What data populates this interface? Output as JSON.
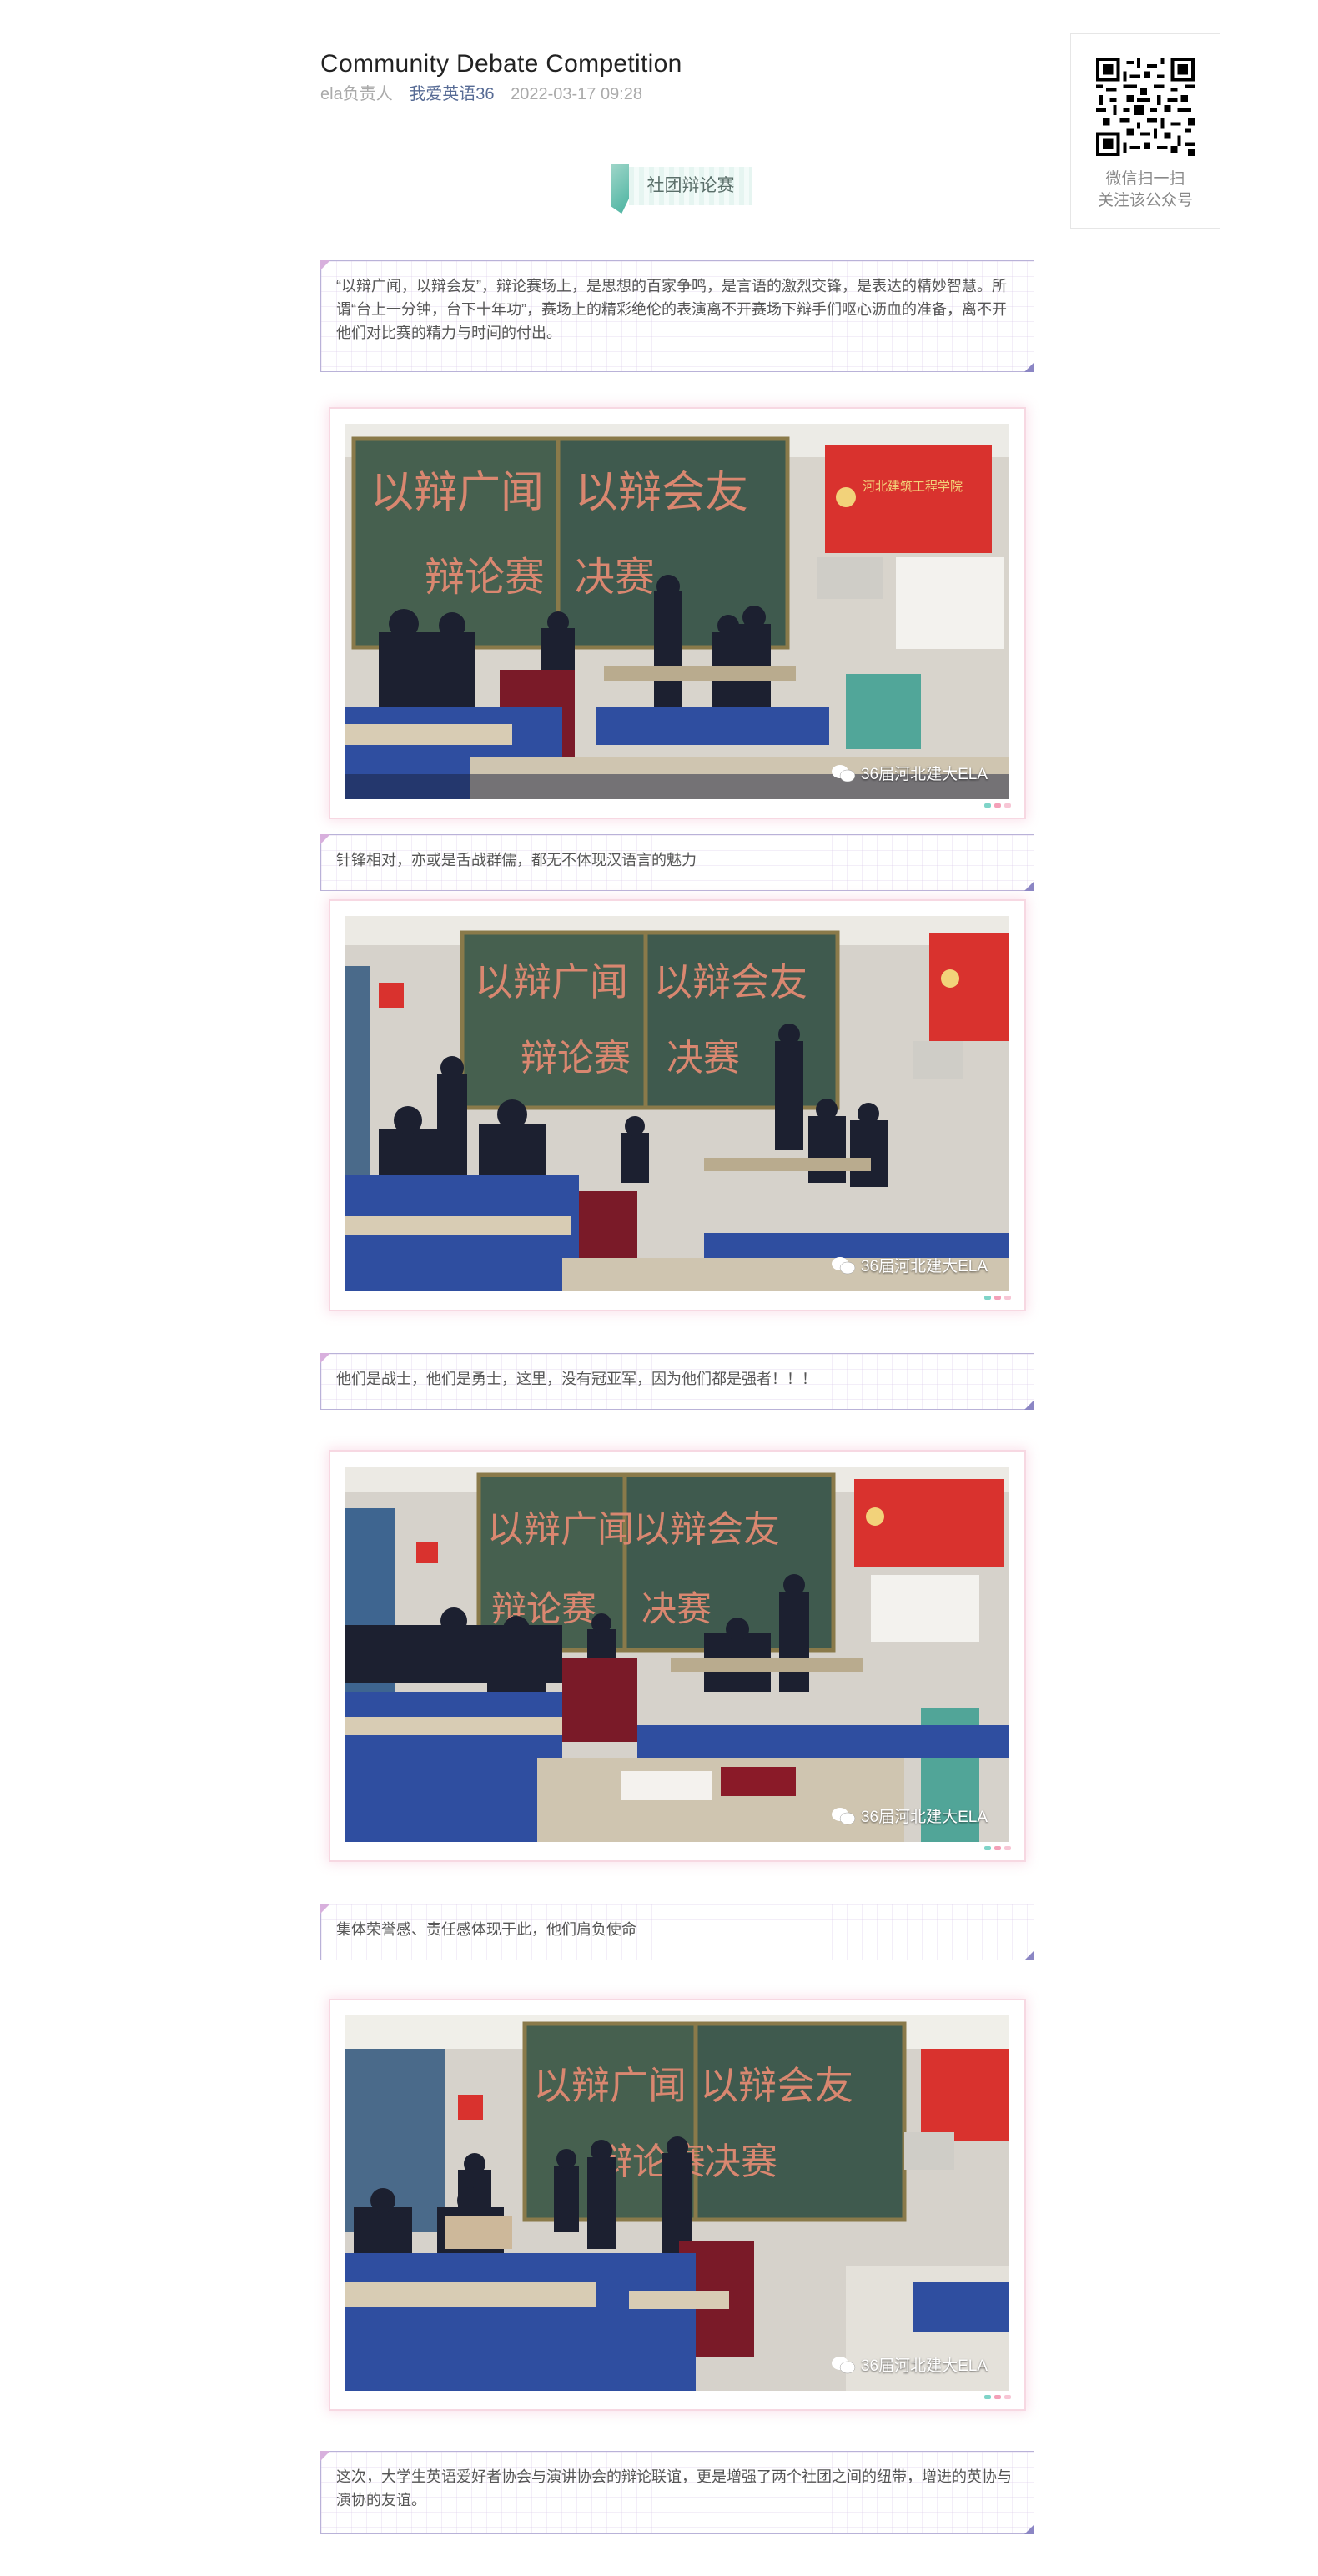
{
  "article": {
    "title": "Community Debate Competition",
    "author": "ela负责人",
    "account": "我爱英语36",
    "date": "2022-03-17 09:28"
  },
  "qr": {
    "line1": "微信扫一扫",
    "line2": "关注该公众号"
  },
  "section_tag": "社团辩论赛",
  "paragraphs": [
    "“以辩广闻，以辩会友”，辩论赛场上，是思想的百家争鸣，是言语的激烈交锋，是表达的精妙智慧。所谓“台上一分钟，台下十年功”，赛场上的精彩绝伦的表演离不开赛场下辩手们呕心沥血的准备，离不开他们对比赛的精力与时间的付出。",
    "针锋相对，亦或是舌战群儒，都无不体现汉语言的魅力",
    "他们是战士，他们是勇士，这里，没有冠亚军，因为他们都是强者！！！",
    "集体荣誉感、责任感体现于此，他们肩负使命",
    "这次，大学生英语爱好者协会与演讲协会的辩论联谊，更是增强了两个社团之间的纽带，增进的英协与演协的友谊。"
  ],
  "photo_watermark": "36届河北建大ELA",
  "board_text": {
    "line1_left": "以辩广闻",
    "line1_right": "以辩会友",
    "line2_left": "辩论赛",
    "line2_right": "决赛"
  },
  "banner_text": "河北建筑工程学院",
  "colors": {
    "board": "#3f5a4e",
    "chalk": "#d98770",
    "banner": "#d9322e",
    "seat": "#2f4ea0",
    "accent_link": "#576b95"
  }
}
